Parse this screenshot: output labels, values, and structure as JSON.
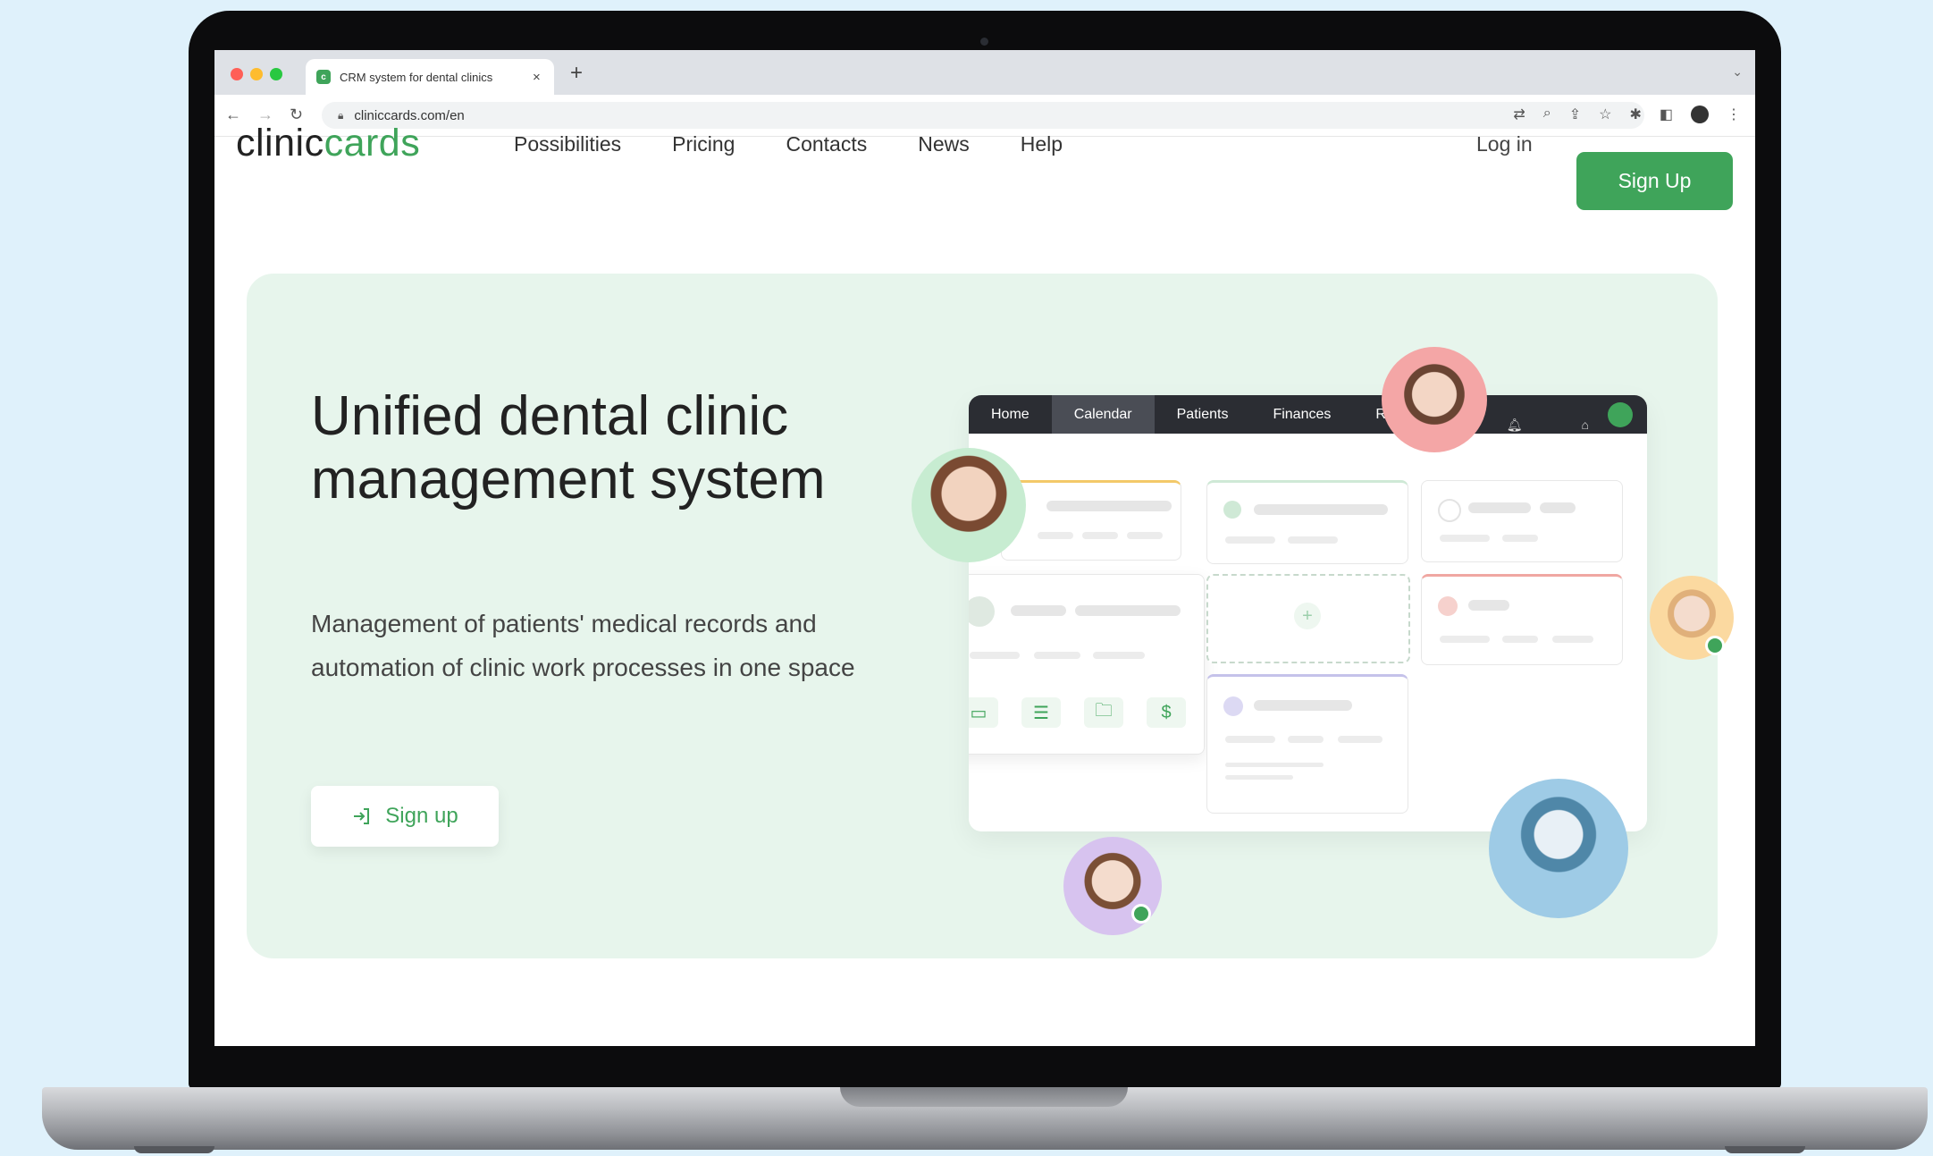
{
  "browser": {
    "tab_title": "CRM system for dental clinics",
    "tab_close": "×",
    "new_tab": "+",
    "url": "cliniccards.com/en"
  },
  "site": {
    "logo_part1": "clinic",
    "logo_part2": "cards",
    "nav": [
      "Possibilities",
      "Pricing",
      "Contacts",
      "News",
      "Help"
    ],
    "login_label": "Log in",
    "signup_label": "Sign Up"
  },
  "hero": {
    "title": "Unified dental clinic management system",
    "subtitle": "Management of patients' medical records and automation of clinic work processes in one space",
    "button_label": "Sign up"
  },
  "mockup": {
    "nav": [
      "Home",
      "Calendar",
      "Patients",
      "Finances",
      "Re"
    ],
    "active_tab": "Calendar",
    "add_symbol": "+",
    "dollar_symbol": "$"
  },
  "colors": {
    "brand_green": "#3fa45a",
    "hero_bg": "#e7f5ec",
    "page_bg": "#dff1fb"
  }
}
